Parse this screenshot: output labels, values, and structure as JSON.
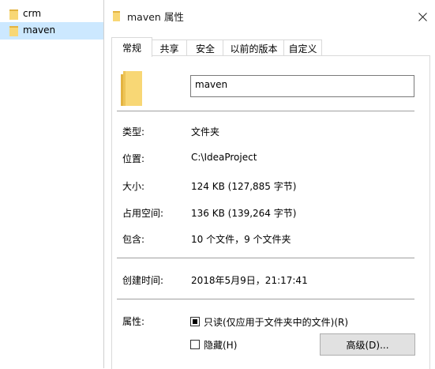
{
  "explorer": {
    "items": [
      {
        "label": "crm",
        "selected": false
      },
      {
        "label": "maven",
        "selected": true
      }
    ]
  },
  "dialog": {
    "title": "maven 属性",
    "close_icon": "close-icon",
    "tabs": [
      {
        "label": "常规",
        "active": true
      },
      {
        "label": "共享",
        "active": false
      },
      {
        "label": "安全",
        "active": false
      },
      {
        "label": "以前的版本",
        "active": false
      },
      {
        "label": "自定义",
        "active": false
      }
    ],
    "name_value": "maven",
    "rows": {
      "type": {
        "label": "类型:",
        "value": "文件夹"
      },
      "location": {
        "label": "位置:",
        "value": "C:\\IdeaProject"
      },
      "size": {
        "label": "大小:",
        "value": "124 KB (127,885 字节)"
      },
      "size_on_disk": {
        "label": "占用空间:",
        "value": "136 KB (139,264 字节)"
      },
      "contains": {
        "label": "包含:",
        "value": "10 个文件，9 个文件夹"
      },
      "created": {
        "label": "创建时间:",
        "value": "2018年5月9日，21:17:41"
      },
      "attributes": {
        "label": "属性:"
      }
    },
    "attributes": {
      "readonly_label": "只读(仅应用于文件夹中的文件)(R)",
      "readonly_state": "mixed",
      "hidden_label": "隐藏(H)",
      "hidden_checked": false,
      "advanced_button": "高级(D)..."
    },
    "colors": {
      "folder_yellow": "#f8d775",
      "folder_dark": "#e3b341",
      "selection": "#cce8ff"
    }
  }
}
